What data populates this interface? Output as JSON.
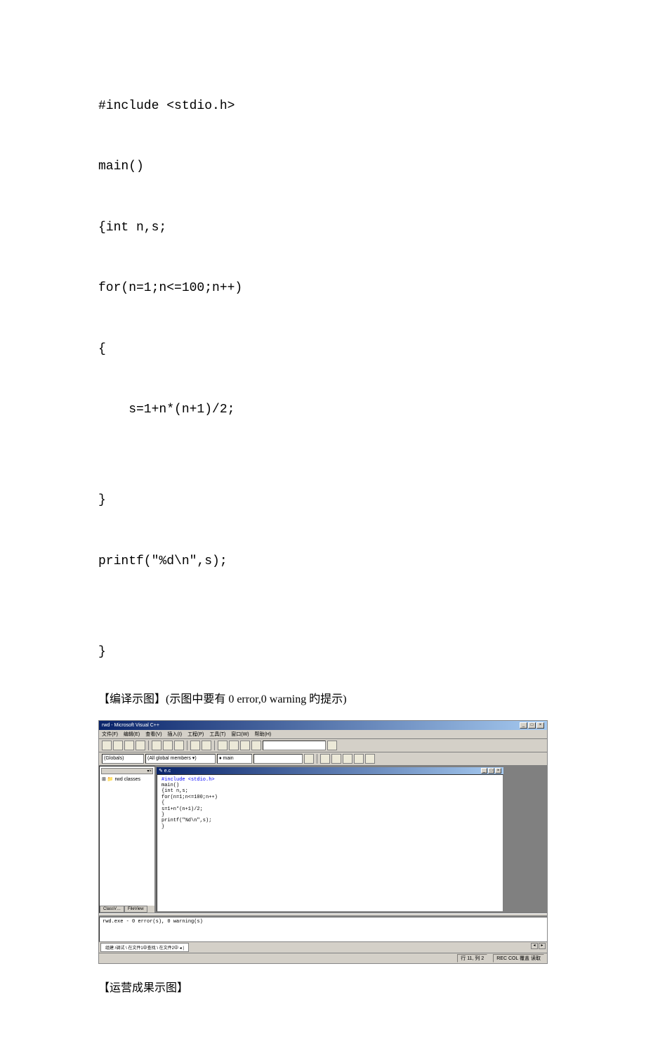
{
  "code": {
    "l1": "#include <stdio.h>",
    "l2": "main()",
    "l3": "{int n,s;",
    "l4": "for(n=1;n<=100;n++)",
    "l5": "{",
    "l6": "    s=1+n*(n+1)/2;",
    "l7": "}",
    "l8": "printf(\"%d\\n\",s);",
    "l9": "}"
  },
  "labels": {
    "compile_section": "【编译示图】(示图中要有 0 error,0 warning 旳提示)",
    "run_section": "【运营成果示图】"
  },
  "ide": {
    "title": "rwd - Microsoft Visual C++",
    "menus": [
      "文件(F)",
      "编辑(E)",
      "查看(V)",
      "插入(I)",
      "工程(P)",
      "工具(T)",
      "窗口(W)",
      "帮助(H)"
    ],
    "dropdowns": {
      "globals": "(Globals)",
      "members": "(All global members ▾)",
      "main": "♦ main"
    },
    "classview": {
      "dropdown_hint": "▾×",
      "root": "⊞ 📁 rwd classes"
    },
    "classview_tabs": [
      "ClassV…",
      "FileView"
    ],
    "editor": {
      "title": "✎ e.c",
      "lines": [
        {
          "text": "#include <stdio.h>",
          "class": "syn-blue"
        },
        {
          "text": "main()",
          "class": ""
        },
        {
          "text": "{int n,s;",
          "class": ""
        },
        {
          "text": "for(n=1;n<=100;n++)",
          "class": ""
        },
        {
          "text": "{",
          "class": ""
        },
        {
          "text": "    s=1+n*(n+1)/2;",
          "class": ""
        },
        {
          "text": "",
          "class": ""
        },
        {
          "text": "}",
          "class": ""
        },
        {
          "text": "printf(\"%d\\n\",s);",
          "class": ""
        },
        {
          "text": "",
          "class": ""
        },
        {
          "text": "}",
          "class": ""
        }
      ]
    },
    "output": {
      "line1": "rwd.exe - 0 error(s), 0 warning(s)",
      "tabs": [
        "组建  /调试 \\  在文件1中查找 \\ 在文件2中 ◂ |"
      ]
    },
    "status": {
      "pos": "行 11, 列 2",
      "caps": "REC COL 覆盖 读取"
    }
  }
}
